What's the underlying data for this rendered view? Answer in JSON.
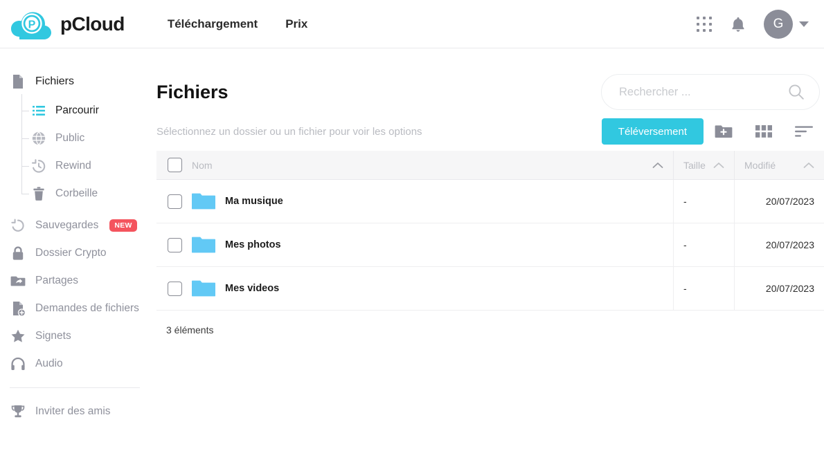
{
  "header": {
    "brand_name": "pCloud",
    "logo_icon": "pcloud-cloud-logo",
    "nav": [
      {
        "label": "Téléchargement",
        "name": "nav-telechargement"
      },
      {
        "label": "Prix",
        "name": "nav-prix"
      }
    ],
    "apps_icon": "apps-grid-icon",
    "notifications_icon": "bell-icon",
    "avatar_initial": "G",
    "avatar_caret_icon": "chevron-down-icon"
  },
  "sidebar": {
    "root": {
      "label": "Fichiers",
      "icon": "file-icon"
    },
    "sub_items": [
      {
        "label": "Parcourir",
        "icon": "list-icon",
        "active": true
      },
      {
        "label": "Public",
        "icon": "globe-icon",
        "active": false
      },
      {
        "label": "Rewind",
        "icon": "history-clock-icon",
        "active": false
      },
      {
        "label": "Corbeille",
        "icon": "trash-icon",
        "active": false
      }
    ],
    "items": [
      {
        "label": "Sauvegardes",
        "icon": "backup-restore-icon",
        "badge": "NEW"
      },
      {
        "label": "Dossier Crypto",
        "icon": "lock-icon",
        "badge": ""
      },
      {
        "label": "Partages",
        "icon": "shared-folder-icon",
        "badge": ""
      },
      {
        "label": "Demandes de fichiers",
        "icon": "file-request-icon",
        "badge": ""
      },
      {
        "label": "Signets",
        "icon": "star-icon",
        "badge": ""
      },
      {
        "label": "Audio",
        "icon": "headphones-icon",
        "badge": ""
      }
    ],
    "footer_items": [
      {
        "label": "Inviter des amis",
        "icon": "trophy-icon"
      }
    ]
  },
  "main": {
    "page_title": "Fichiers",
    "search": {
      "placeholder": "Rechercher ...",
      "value": "",
      "icon": "search-icon"
    },
    "toolbar": {
      "hint": "Sélectionnez un dossier ou un fichier pour voir les options",
      "upload_label": "Téléversement",
      "new_folder_icon": "new-folder-icon",
      "grid_view_icon": "grid-view-icon",
      "sort_icon": "sort-icon"
    },
    "table": {
      "columns": [
        {
          "label": "Nom",
          "name": "column-nom",
          "sort_icon": "chevron-up-icon"
        },
        {
          "label": "Taille",
          "name": "column-taille",
          "sort_icon": "chevron-up-icon"
        },
        {
          "label": "Modifié",
          "name": "column-modifie",
          "sort_icon": "chevron-up-icon"
        }
      ],
      "rows": [
        {
          "name": "Ma musique",
          "size": "-",
          "modified": "20/07/2023",
          "icon": "folder-icon"
        },
        {
          "name": "Mes photos",
          "size": "-",
          "modified": "20/07/2023",
          "icon": "folder-icon"
        },
        {
          "name": "Mes videos",
          "size": "-",
          "modified": "20/07/2023",
          "icon": "folder-icon"
        }
      ]
    },
    "footer_count": "3 éléments"
  },
  "colors": {
    "accent": "#31c8e0",
    "folder": "#62c9f5",
    "badge": "#f4545e",
    "muted": "#8f919c"
  }
}
